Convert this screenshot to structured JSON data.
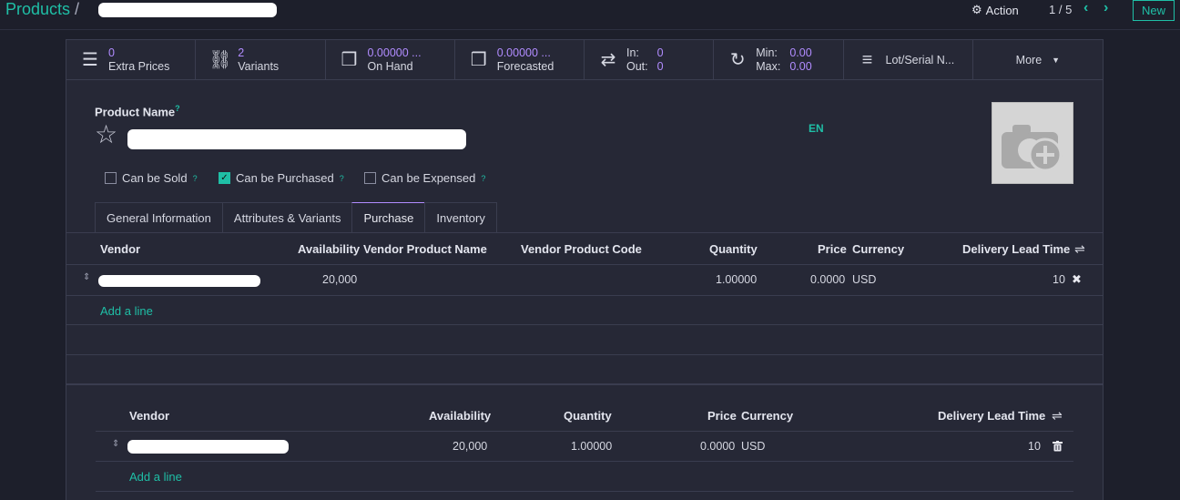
{
  "breadcrumb": {
    "root": "Products",
    "separator": "/"
  },
  "control": {
    "action_label": "Action",
    "pager": "1 / 5",
    "new_label": "New"
  },
  "smart_buttons": {
    "extra_prices": {
      "value": "0",
      "label": "Extra Prices",
      "icon": "list-icon"
    },
    "variants": {
      "value": "2",
      "label": "Variants",
      "icon": "sitemap-icon"
    },
    "on_hand": {
      "value": "0.00000 ...",
      "label": "On Hand",
      "icon": "cubes-icon"
    },
    "forecasted": {
      "value": "0.00000 ...",
      "label": "Forecasted",
      "icon": "cubes-icon"
    },
    "in_out": {
      "in_label": "In:",
      "in_value": "0",
      "out_label": "Out:",
      "out_value": "0",
      "icon": "exchange-icon"
    },
    "min_max": {
      "min_label": "Min:",
      "min_value": "0.00",
      "max_label": "Max:",
      "max_value": "0.00",
      "icon": "refresh-icon"
    },
    "lot_serial": {
      "label": "Lot/Serial N...",
      "icon": "bars-icon"
    },
    "more": {
      "label": "More"
    }
  },
  "form": {
    "product_name_label": "Product Name",
    "help_mark": "?",
    "lang": "EN",
    "can_be_sold": "Can be Sold",
    "can_be_purchased": "Can be Purchased",
    "can_be_expensed": "Can be Expensed",
    "checked": {
      "sold": false,
      "purchased": true,
      "expensed": false
    }
  },
  "tabs": [
    "General Information",
    "Attributes & Variants",
    "Purchase",
    "Inventory"
  ],
  "vendor_table_1": {
    "headers": [
      "Vendor",
      "Availability",
      "Vendor Product Name",
      "Vendor Product Code",
      "Quantity",
      "Price",
      "Currency",
      "Delivery Lead Time"
    ],
    "row": {
      "availability": "20,000",
      "quantity": "1.00000",
      "price": "0.0000",
      "currency": "USD",
      "lead_time": "10"
    },
    "add_line": "Add a line"
  },
  "vendor_table_2": {
    "headers": [
      "Vendor",
      "Availability",
      "Quantity",
      "Price",
      "Currency",
      "Delivery Lead Time"
    ],
    "row": {
      "availability": "20,000",
      "quantity": "1.00000",
      "price": "0.0000",
      "currency": "USD",
      "lead_time": "10"
    },
    "add_line": "Add a line"
  },
  "colors": {
    "accent": "#1fbfa6",
    "stat_value": "#b18cff",
    "background": "#1d1f2b",
    "sheet": "#262836"
  }
}
